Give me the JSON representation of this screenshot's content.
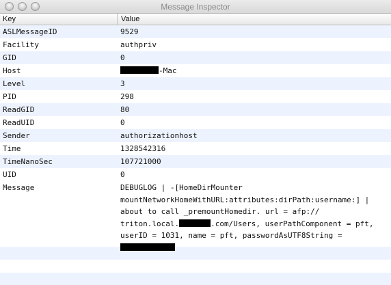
{
  "window": {
    "title": "Message Inspector"
  },
  "columns": {
    "key": "Key",
    "value": "Value"
  },
  "rows": [
    {
      "key": "ASLMessageID",
      "value": "9529"
    },
    {
      "key": "Facility",
      "value": "authpriv"
    },
    {
      "key": "GID",
      "value": "0"
    },
    {
      "key": "Host",
      "value": "-Mac"
    },
    {
      "key": "Level",
      "value": "3"
    },
    {
      "key": "PID",
      "value": "298"
    },
    {
      "key": "ReadGID",
      "value": "80"
    },
    {
      "key": "ReadUID",
      "value": "0"
    },
    {
      "key": "Sender",
      "value": "authorizationhost"
    },
    {
      "key": "Time",
      "value": "1328542316"
    },
    {
      "key": "TimeNanoSec",
      "value": "107721000"
    },
    {
      "key": "UID",
      "value": "0"
    }
  ],
  "message": {
    "key": "Message",
    "lines": [
      "DEBUGLOG | -[HomeDirMounter",
      "mountNetworkHomeWithURL:attributes:dirPath:username:] |",
      "about to call _premountHomedir. url = afp://",
      "triton.local.",
      ".com/Users, userPathComponent = pft,",
      "userID = 1031, name = pft, passwordAsUTF8String ="
    ]
  }
}
